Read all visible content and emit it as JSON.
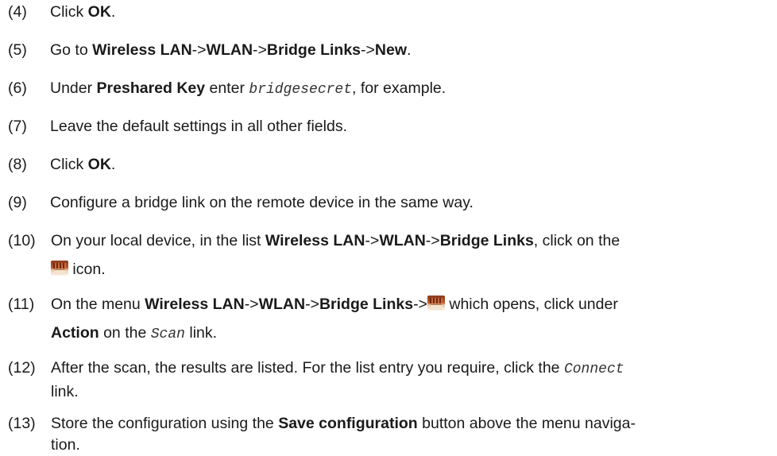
{
  "steps": [
    {
      "num": "(4)",
      "parts": [
        "Click ",
        "OK",
        "."
      ]
    },
    {
      "num": "(5)",
      "parts": [
        "Go to ",
        "Wireless LAN",
        "->",
        "WLAN",
        "->",
        "Bridge Links",
        "->",
        "New",
        "."
      ]
    },
    {
      "num": "(6)",
      "parts": [
        "Under ",
        "Preshared Key",
        " enter ",
        "bridgesecret",
        ", for example."
      ]
    },
    {
      "num": "(7)",
      "parts": [
        "Leave the default settings in all other fields."
      ]
    },
    {
      "num": "(8)",
      "parts": [
        "Click ",
        "OK",
        "."
      ]
    },
    {
      "num": "(9)",
      "parts": [
        "Configure a bridge link on the remote device in the same way."
      ]
    },
    {
      "num": "(10)",
      "parts": [
        "On your local device, in the list ",
        "Wireless LAN",
        "->",
        "WLAN",
        "->",
        "Bridge Links",
        ", click on the",
        " icon."
      ]
    },
    {
      "num": "(11)",
      "parts": [
        "On the menu ",
        "Wireless LAN",
        "->",
        "WLAN",
        "->",
        "Bridge Links",
        "->",
        " which opens, click under",
        "Action",
        " on the ",
        "Scan",
        " link."
      ]
    },
    {
      "num": "(12)",
      "parts": [
        "After the scan, the results are listed. For the list entry you require, click the ",
        "Connect",
        "link."
      ]
    },
    {
      "num": "(13)",
      "parts": [
        "Store the configuration using the ",
        "Save configuration",
        " button above the menu naviga-",
        "tion."
      ]
    }
  ],
  "icons": {
    "bridge_link_icon": "bridge-scan-icon"
  }
}
